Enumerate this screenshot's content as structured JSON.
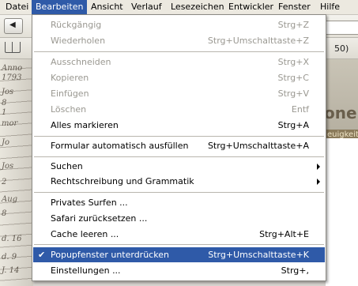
{
  "menubar": {
    "items": [
      {
        "label": "Datei"
      },
      {
        "label": "Bearbeiten"
      },
      {
        "label": "Ansicht"
      },
      {
        "label": "Verlauf"
      },
      {
        "label": "Lesezeichen"
      },
      {
        "label": "Entwickler"
      },
      {
        "label": "Fenster"
      },
      {
        "label": "Hilfe"
      }
    ]
  },
  "toolbar": {
    "back_glyph": "◀"
  },
  "bookmarks": {
    "count_text": "50)"
  },
  "page": {
    "manuscript_lines": [
      "Anno",
      "1793",
      "Jos",
      "8",
      "1",
      "mor",
      "Jo",
      "Jos",
      "2",
      "Aug",
      "8",
      "d. 16",
      "d. 9",
      "J. 14"
    ],
    "banner_text": "one",
    "banner_subtext": "euigkeit"
  },
  "edit_menu": {
    "items": [
      {
        "label": "Rückgängig",
        "shortcut": "Strg+Z",
        "disabled": true
      },
      {
        "label": "Wiederholen",
        "shortcut": "Strg+Umschalttaste+Z",
        "disabled": true
      },
      {
        "label": "Ausschneiden",
        "shortcut": "Strg+X",
        "disabled": true
      },
      {
        "label": "Kopieren",
        "shortcut": "Strg+C",
        "disabled": true
      },
      {
        "label": "Einfügen",
        "shortcut": "Strg+V",
        "disabled": true
      },
      {
        "label": "Löschen",
        "shortcut": "Entf",
        "disabled": true
      },
      {
        "label": "Alles markieren",
        "shortcut": "Strg+A",
        "disabled": false
      },
      {
        "label": "Formular automatisch ausfüllen",
        "shortcut": "Strg+Umschalttaste+A",
        "disabled": false
      },
      {
        "label": "Suchen",
        "shortcut": "",
        "submenu": true
      },
      {
        "label": "Rechtschreibung und Grammatik",
        "shortcut": "",
        "submenu": true
      },
      {
        "label": "Privates Surfen ...",
        "shortcut": ""
      },
      {
        "label": "Safari zurücksetzen ...",
        "shortcut": ""
      },
      {
        "label": "Cache leeren ...",
        "shortcut": "Strg+Alt+E"
      },
      {
        "label": "Popupfenster unterdrücken",
        "shortcut": "Strg+Umschalttaste+K",
        "checked": true,
        "highlighted": true
      },
      {
        "label": "Einstellungen ...",
        "shortcut": "Strg+,"
      }
    ],
    "check_glyph": "✔"
  }
}
